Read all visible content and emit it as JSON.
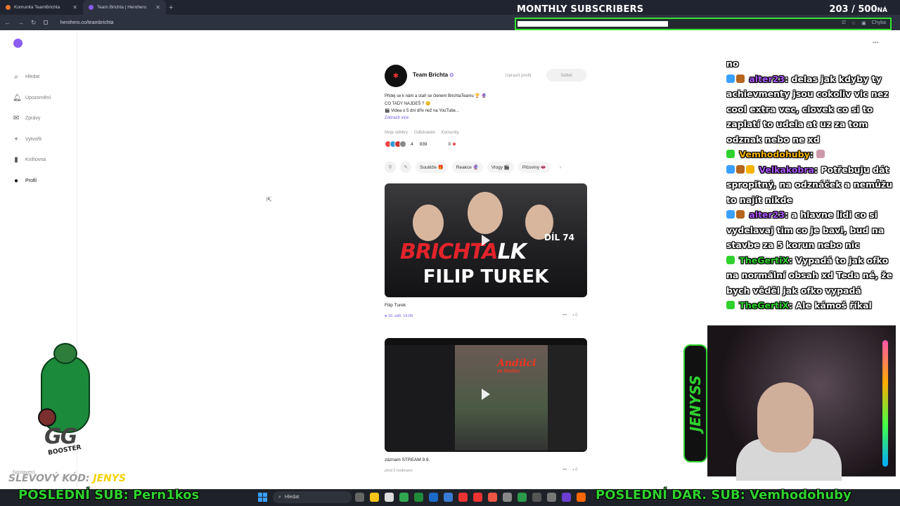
{
  "browser": {
    "tabs": [
      {
        "title": "Komunita TeamBrichta",
        "color": "#f5792a",
        "active": false
      },
      {
        "title": "Team Brichta | Herohero",
        "color": "#8b5cf6",
        "active": true
      }
    ],
    "url": "herohero.co/teambrichta"
  },
  "overlay": {
    "subs_title": "MONTHLY SUBSCRIBERS",
    "subs_count": "203 / 500",
    "subs_count_suffix": "NÁ",
    "subs_progress": 0.406,
    "addr_right": "Chyba",
    "discount_code_label": "SLEVOVÝ KÓD:",
    "discount_code": "JENYS",
    "last_sub_label": "POSLEDNÍ SUB:",
    "last_sub_name": "Pern1kos",
    "last_dar_label": "POSLEDNÍ DAR. SUB:",
    "last_dar_name": "Vemhodohuby",
    "jenyss_logo": "JENYSS",
    "mascot_text": "GG",
    "mascot_sub": "BOOSTER"
  },
  "sidebar": {
    "items": [
      {
        "label": "Hledat",
        "icon": "search-icon"
      },
      {
        "label": "Upozornění",
        "icon": "bell-icon"
      },
      {
        "label": "Zprávy",
        "icon": "mail-icon"
      },
      {
        "label": "Vytvořit",
        "icon": "plus-icon"
      },
      {
        "label": "Knihovna",
        "icon": "bookmark-icon"
      },
      {
        "label": "Profil",
        "icon": "profile-icon"
      }
    ],
    "settings": "Nastavení"
  },
  "profile": {
    "name": "Team Brichta",
    "edit_label": "Upravit profil",
    "share_label": "Sdílet",
    "bio_lines": [
      "Přidej se k nám a staň se členem BrichtaTeamu 🏆 🔮",
      "CO TADY NAJDEŠ ? 😊",
      "🎬 Videa o 5 dní dřív než na YouTube..."
    ],
    "show_more": "Zobrazit více",
    "stats_labels": [
      "Moje odběry",
      "Odběratelé",
      "Komunity"
    ],
    "stats_values": {
      "subs": "4",
      "followers": "939",
      "communities": "0"
    }
  },
  "tags": [
    "Soutěže 🎁",
    "Reakce 🔮",
    "Vlogy 🎬",
    "Pičoviny 👄"
  ],
  "posts": [
    {
      "title": "Filip Turek",
      "date": "10. září, 19:00",
      "comments": "0",
      "thumb_main": "BRICHTA",
      "thumb_suffix": "LK",
      "thumb_episode": "DÍL 74",
      "thumb_guest": "FILIP TUREK"
    },
    {
      "title": "záznam STREAM 9.9.",
      "date": "před 5 hodinami",
      "comments": "0",
      "thumb_main": "Andílci",
      "thumb_sub": "za školou"
    }
  ],
  "chat": [
    {
      "text": "no",
      "user": "",
      "color": "#fff"
    },
    {
      "user": "alter23",
      "color": "#a855f7",
      "text": ": delas jak kdyby ty achievmenty jsou cokoliv vic nez cool extra vec, clovek co si to zaplatí to udela at uz za tom odznak nebo ne xd"
    },
    {
      "user": "Vemhodohuby",
      "color": "#f5b400",
      "text": ":"
    },
    {
      "user": "Velkakobra",
      "color": "#a855f7",
      "text": ": Potřebuju dát spropitný, na odznáček a nemůžu to najít nikde"
    },
    {
      "user": "alter23",
      "color": "#a855f7",
      "text": ": a hlavne lidi co si vydelavaj tim co je bavi, bud na stavbe za 5 korun nebo nic"
    },
    {
      "user": "TheGertiX",
      "color": "#2fd12f",
      "text": ": Vypadá to jak ofko na normální obsah xd Teda né, že bych věděl jak ofko vypadá"
    },
    {
      "user": "TheGertiX",
      "color": "#2fd12f",
      "text": ": Ale kámoš říkal"
    }
  ],
  "taskbar": {
    "search_placeholder": "Hledat"
  }
}
